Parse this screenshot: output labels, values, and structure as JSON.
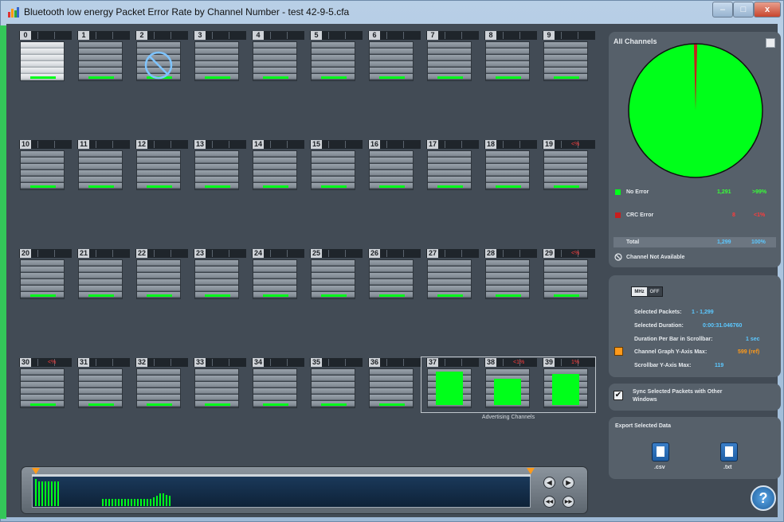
{
  "window": {
    "title": "Bluetooth low energy Packet Error Rate by Channel Number - test 42-9-5.cfa",
    "controls": {
      "minimize": "–",
      "maximize": "□",
      "close": "x"
    }
  },
  "channels": [
    {
      "num": "0",
      "state": "light"
    },
    {
      "num": "1"
    },
    {
      "num": "2",
      "state": "not-available"
    },
    {
      "num": "3"
    },
    {
      "num": "4"
    },
    {
      "num": "5"
    },
    {
      "num": "6"
    },
    {
      "num": "7"
    },
    {
      "num": "8"
    },
    {
      "num": "9"
    },
    {
      "num": "10"
    },
    {
      "num": "11"
    },
    {
      "num": "12"
    },
    {
      "num": "13"
    },
    {
      "num": "14"
    },
    {
      "num": "15"
    },
    {
      "num": "16"
    },
    {
      "num": "17"
    },
    {
      "num": "18"
    },
    {
      "num": "19",
      "pct": "<%"
    },
    {
      "num": "20"
    },
    {
      "num": "21"
    },
    {
      "num": "22"
    },
    {
      "num": "23"
    },
    {
      "num": "24"
    },
    {
      "num": "25"
    },
    {
      "num": "26"
    },
    {
      "num": "27"
    },
    {
      "num": "28"
    },
    {
      "num": "29",
      "pct": "<%"
    },
    {
      "num": "30",
      "pct": "<%"
    },
    {
      "num": "31"
    },
    {
      "num": "32"
    },
    {
      "num": "33"
    },
    {
      "num": "34"
    },
    {
      "num": "35"
    },
    {
      "num": "36"
    },
    {
      "num": "37",
      "big": 0.95
    },
    {
      "num": "38",
      "pct": "<1%",
      "big": 0.75
    },
    {
      "num": "39",
      "pct": "1%",
      "big": 0.88
    }
  ],
  "advertising_label": "Advertising Channels",
  "scrollbar": {
    "bar_values": [
      0.95,
      0.85,
      0.85,
      0.85,
      0.85,
      0.85,
      0.85,
      0.85,
      0.25,
      0.25,
      0.25,
      0.25,
      0.25,
      0.25,
      0.25,
      0.25,
      0.25,
      0.25,
      0.25,
      0.25,
      0.25,
      0.25,
      0.25,
      0.25,
      0.3,
      0.35,
      0.45,
      0.45,
      0.4,
      0.35
    ],
    "nav": {
      "prev": "◀",
      "next": "▶",
      "first": "◀◀",
      "last": "▶▶"
    }
  },
  "all_channels": {
    "title": "All Channels",
    "pie": {
      "no_error_fraction": 0.992,
      "colors": {
        "no_error": "#00ff1a",
        "crc_error": "#c81e1e"
      }
    },
    "legend": {
      "no_error": {
        "label": "No Error",
        "count": "1,291",
        "pct": ">99%"
      },
      "crc_error": {
        "label": "CRC Error",
        "count": "8",
        "pct": "<1%"
      },
      "total": {
        "label": "Total",
        "count": "1,299",
        "pct": "100%"
      },
      "not_available": "Channel Not Available"
    }
  },
  "info": {
    "toggle": {
      "on": "MHz",
      "off": "OFF"
    },
    "selected_packets_label": "Selected Packets:",
    "selected_packets_value": "1 - 1,299",
    "selected_duration_label": "Selected Duration:",
    "selected_duration_value": "0:00:31.046760",
    "duration_per_bar_label": "Duration Per Bar in Scrollbar:",
    "duration_per_bar_value": "1 sec",
    "y_axis_max_label": "Channel Graph Y-Axis Max:",
    "y_axis_max_value": "599 (ref)",
    "scroll_y_axis_label": "Scrollbar Y-Axis Max:",
    "scroll_y_axis_value": "119"
  },
  "sync": {
    "checked": true,
    "line1": "Sync Selected Packets with Other",
    "line2": "Windows"
  },
  "export": {
    "title": "Export Selected Data",
    "csv": ".csv",
    "txt": ".txt"
  },
  "help": "?"
}
